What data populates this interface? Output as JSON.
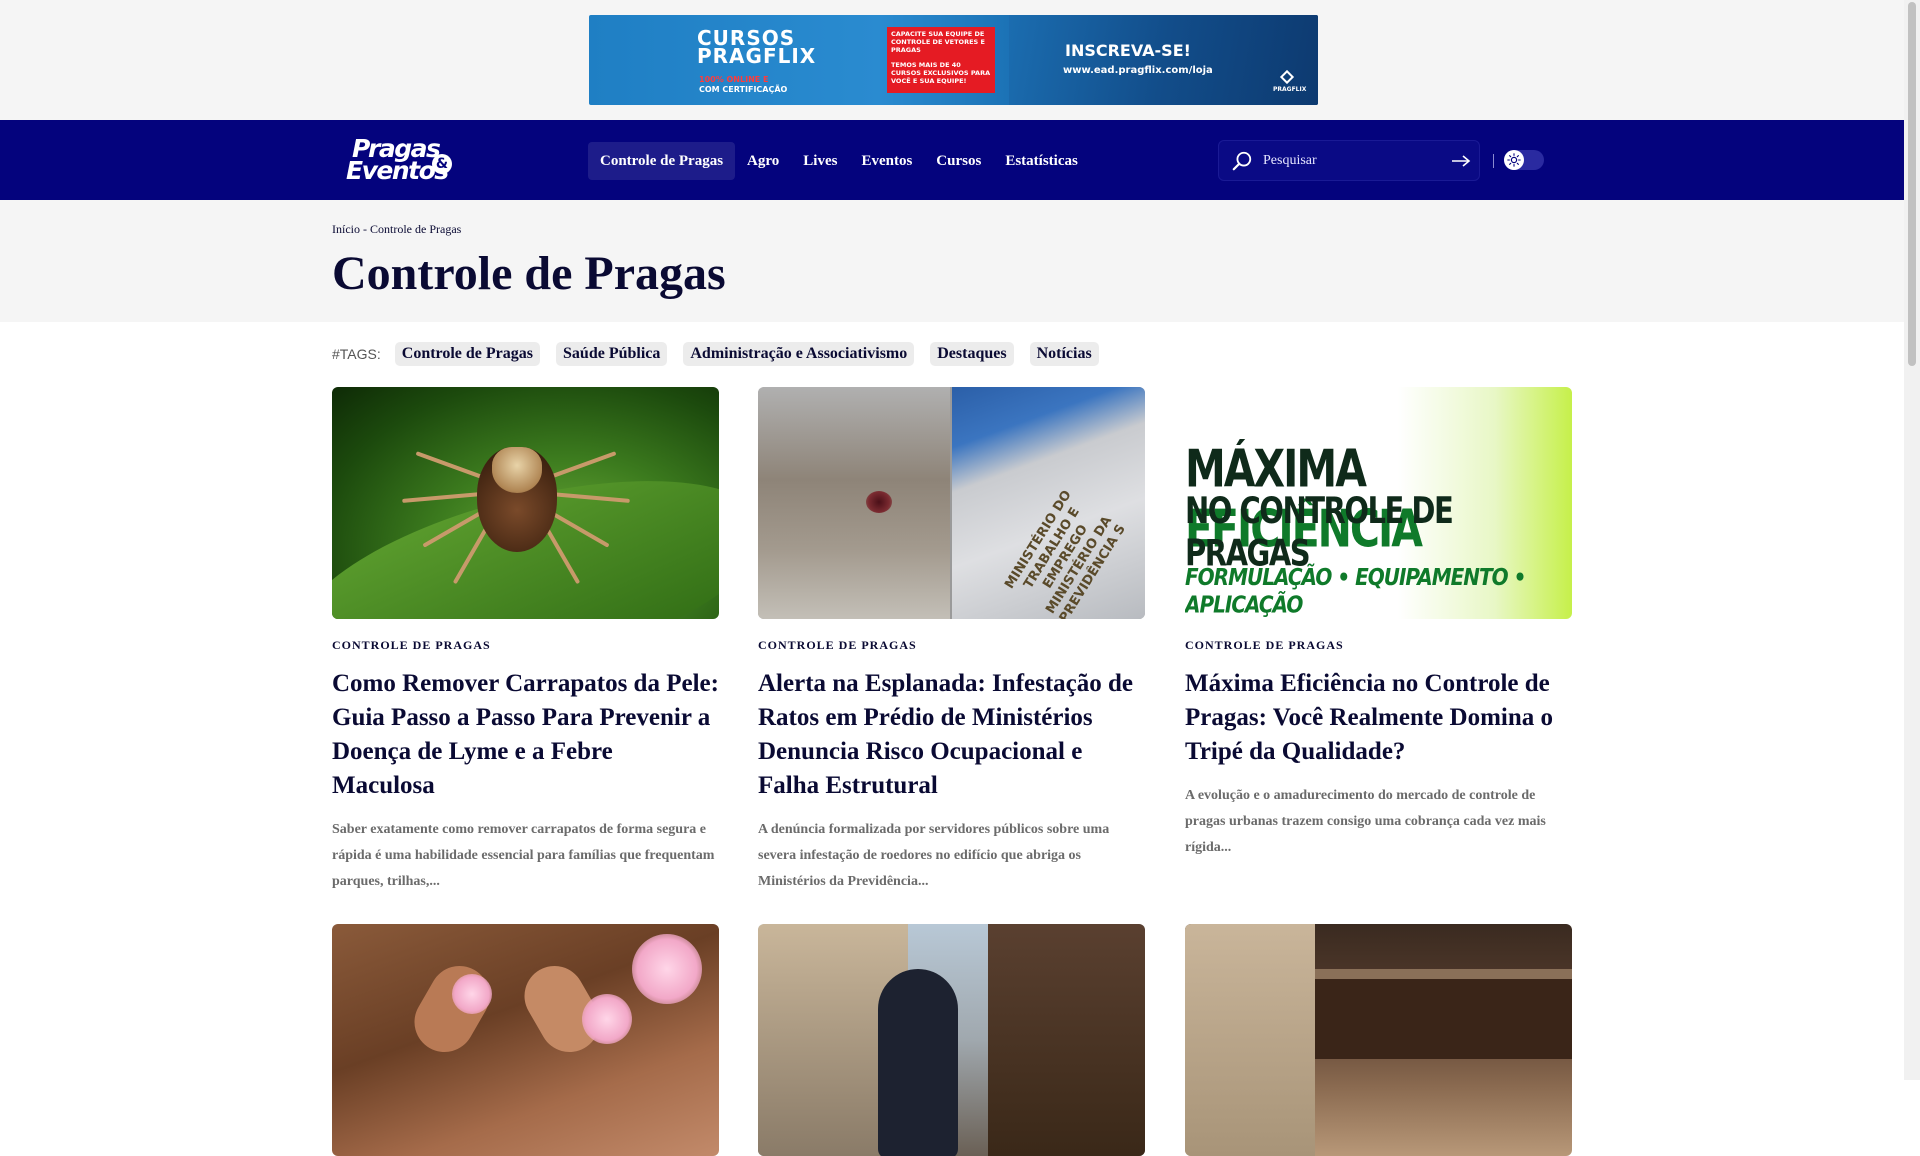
{
  "ad": {
    "brand": "CURSOS PRAGFLIX",
    "brand_sub_highlight": "100% ONLINE E",
    "brand_sub": "COM CERTIFICAÇÃO",
    "red_line1": "CAPACITE SUA EQUIPE DE CONTROLE DE VETORES E PRAGAS",
    "red_line2": "TEMOS MAIS DE 40 CURSOS EXCLUSIVOS PARA VOCÊ E SUA EQUIPE!",
    "cta": "INSCREVA-SE!",
    "url": "www.ead.pragflix.com/loja",
    "mini_logo": "PRAGFLIX"
  },
  "header": {
    "logo_line1": "Pragas",
    "logo_line2": "Eventos",
    "logo_amp": "&",
    "menu": [
      {
        "label": "Controle de Pragas",
        "active": true
      },
      {
        "label": "Agro",
        "active": false
      },
      {
        "label": "Lives",
        "active": false
      },
      {
        "label": "Eventos",
        "active": false
      },
      {
        "label": "Cursos",
        "active": false
      },
      {
        "label": "Estatísticas",
        "active": false
      }
    ],
    "search_placeholder": "Pesquisar",
    "theme_toggle": "light"
  },
  "page": {
    "breadcrumb_home": "Início",
    "breadcrumb_sep": " - ",
    "breadcrumb_current": "Controle de Pragas",
    "title": "Controle de Pragas"
  },
  "tags": {
    "label": "#TAGS:",
    "items": [
      "Controle de Pragas",
      "Saúde Pública",
      "Administração e Associativismo",
      "Destaques",
      "Notícias"
    ]
  },
  "promo_image": {
    "line1a": "MÁXIMA ",
    "line1b": "EFICIÊNCIA",
    "line2": "NO CONTROLE DE PRAGAS",
    "line3": "FORMULAÇÃO • EQUIPAMENTO • APLICAÇÃO"
  },
  "rats_image": {
    "wall_text": "MINISTÉRIO DO TRABALHO E EMPREGO MINISTÉRIO DA PREVIDÊNCIA S"
  },
  "articles": [
    {
      "category": "CONTROLE DE PRAGAS",
      "title": "Como Remover Carrapatos da Pele: Guia Passo a Passo Para Prevenir a Doença de Lyme e a Febre Maculosa",
      "excerpt": "Saber exatamente como remover carrapatos de forma segura e rápida é uma habilidade essencial para famílias que frequentam parques, trilhas,..."
    },
    {
      "category": "CONTROLE DE PRAGAS",
      "title": "Alerta na Esplanada: Infestação de Ratos em Prédio de Ministérios Denuncia Risco Ocupacional e Falha Estrutural",
      "excerpt": "A denúncia formalizada por servidores públicos sobre uma severa infestação de roedores no edifício que abriga os Ministérios da Previdência..."
    },
    {
      "category": "CONTROLE DE PRAGAS",
      "title": "Máxima Eficiência no Controle de Pragas: Você Realmente Domina o Tripé da Qualidade?",
      "excerpt": "A evolução e o amadurecimento do mercado de controle de pragas urbanas trazem consigo uma cobrança cada vez mais rígida..."
    }
  ],
  "colors": {
    "nav_bg": "#04037d",
    "text_dark": "#0a0a33",
    "excerpt": "#6b6b6b",
    "promo_green": "#0f7a2a"
  }
}
